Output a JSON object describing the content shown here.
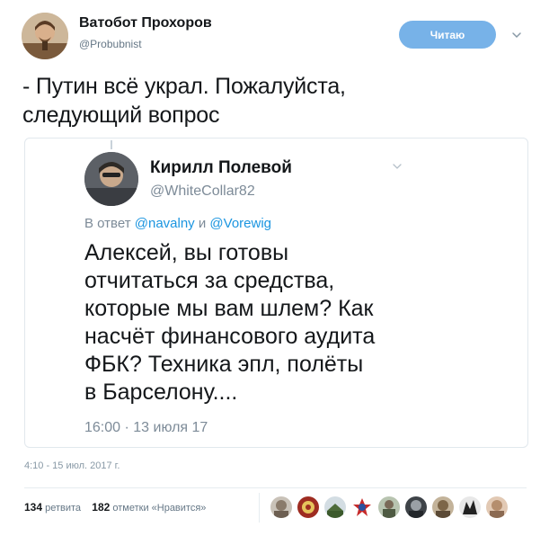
{
  "tweet": {
    "author": {
      "name": "Ватобот Прохоров",
      "handle": "@Probubnist"
    },
    "follow_label": "Читаю",
    "text": "- Путин всё украл. Пожалуйста,\nследующий вопрос",
    "date": "4:10 - 15 июл. 2017 г.",
    "stats": {
      "retweets_count": "134",
      "retweets_label": "ретвита",
      "likes_count": "182",
      "likes_label": "отметки «Нравится»"
    }
  },
  "embedded": {
    "author": {
      "name": "Кирилл Полевой",
      "handle": "@WhiteCollar82"
    },
    "reply": {
      "prefix": "В ответ",
      "mention1": "@navalny",
      "conj": "и",
      "mention2": "@Vorewig"
    },
    "text": "Алексей, вы готовы\nотчитаться за средства,\nкоторые мы вам шлем? Как\nнасчёт финансового аудита\nФБК? Техника эпл, полёты\nв Барселону....",
    "time": "16:00 · 13 июля 17"
  },
  "colors": {
    "accent": "#1b95e0",
    "follow_button": "#77b2e8"
  },
  "icons": {
    "caret": "chevron-down-icon"
  }
}
